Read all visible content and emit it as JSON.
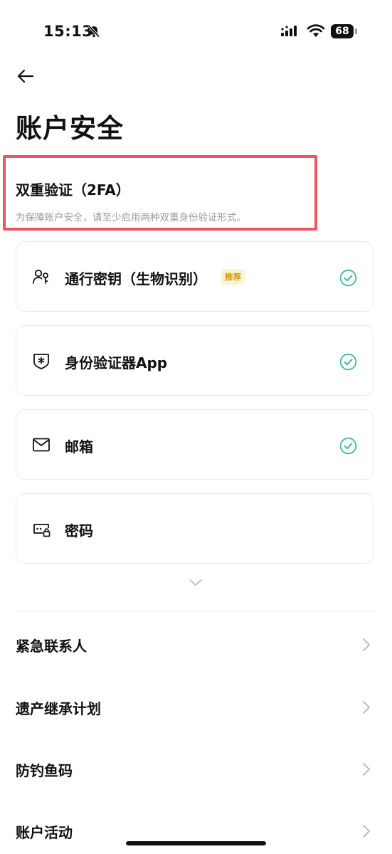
{
  "status_bar": {
    "time": "15:13",
    "battery": "68"
  },
  "page": {
    "title": "账户安全"
  },
  "two_fa": {
    "title": "双重验证（2FA）",
    "description": "为保障账户安全，请至少启用两种双重身份验证形式。"
  },
  "methods": [
    {
      "label": "通行密钥（生物识别）",
      "badge": "推荐",
      "enabled": true,
      "icon": "passkey-icon"
    },
    {
      "label": "身份验证器App",
      "enabled": true,
      "icon": "authenticator-shield-icon"
    },
    {
      "label": "邮箱",
      "enabled": true,
      "icon": "mail-icon"
    },
    {
      "label": "密码",
      "enabled": false,
      "icon": "password-lock-icon"
    }
  ],
  "menu": [
    {
      "label": "紧急联系人"
    },
    {
      "label": "遗产继承计划"
    },
    {
      "label": "防钓鱼码"
    },
    {
      "label": "账户活动"
    }
  ],
  "colors": {
    "check": "#3dba8c",
    "highlight": "#ef5560",
    "badge_bg": "#fbf3d4",
    "badge_text": "#c99a0e"
  }
}
